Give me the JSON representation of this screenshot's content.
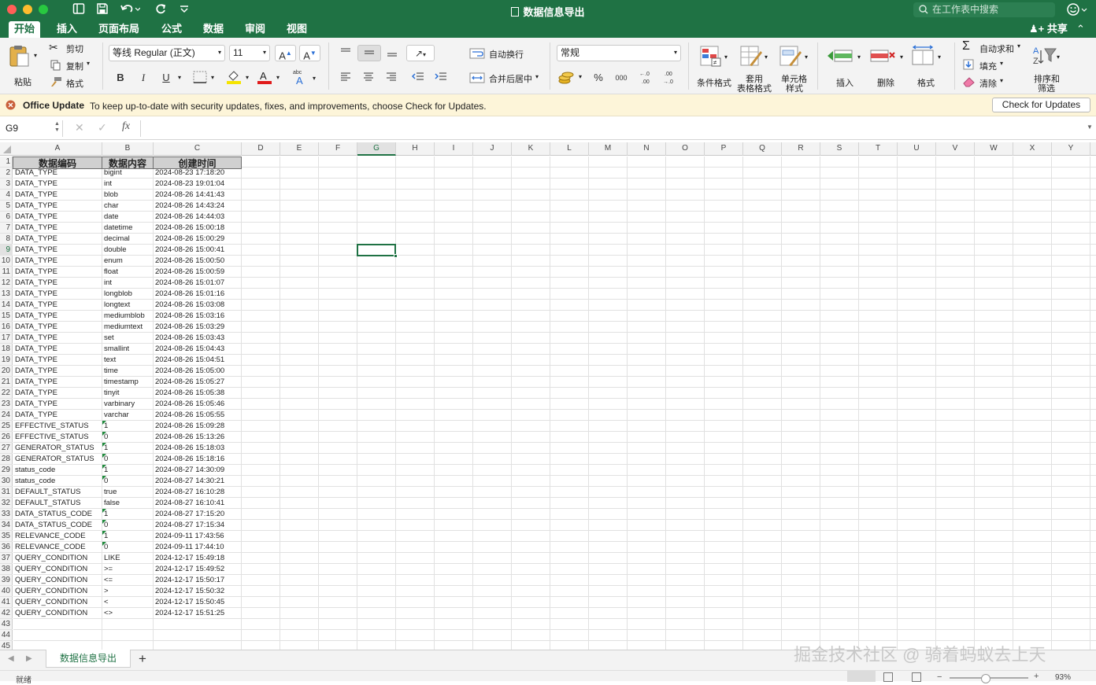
{
  "window": {
    "title": "数据信息导出",
    "search_placeholder": "在工作表中搜索"
  },
  "ribbon_tabs": [
    "开始",
    "插入",
    "页面布局",
    "公式",
    "数据",
    "审阅",
    "视图"
  ],
  "share_label": "共享",
  "clipboard": {
    "paste": "粘贴",
    "cut": "剪切",
    "copy": "复制",
    "format": "格式"
  },
  "font": {
    "name": "等线 Regular (正文)",
    "size": "11",
    "bold": "B",
    "italic": "I",
    "underline": "U",
    "grow": "A",
    "shrink": "A"
  },
  "alignment": {
    "wrap": "自动换行",
    "merge": "合并后居中"
  },
  "number": {
    "format": "常规",
    "percent": "%",
    "thousands": "000"
  },
  "styles": {
    "conditional": "条件格式",
    "table_fmt_1": "套用",
    "table_fmt_2": "表格格式",
    "cell_style_1": "单元格",
    "cell_style_2": "样式"
  },
  "cells_group": {
    "insert": "插入",
    "delete": "删除",
    "format": "格式"
  },
  "editing": {
    "autosum": "自动求和",
    "fill": "填充",
    "clear": "清除",
    "sort_1": "排序和",
    "sort_2": "筛选"
  },
  "update_notice": {
    "title": "Office Update",
    "message": "To keep up-to-date with security updates, fixes, and improvements, choose Check for Updates.",
    "button": "Check for Updates"
  },
  "formula_bar": {
    "name_box": "G9",
    "fx": "fx",
    "formula": ""
  },
  "columns": [
    "A",
    "B",
    "C",
    "D",
    "E",
    "F",
    "G",
    "H",
    "I",
    "J",
    "K",
    "L",
    "M",
    "N",
    "O",
    "P",
    "Q",
    "R",
    "S",
    "T",
    "U",
    "V",
    "W",
    "X",
    "Y"
  ],
  "selected_cell": "G9",
  "header_row": [
    "数据编码",
    "数据内容",
    "创建时间"
  ],
  "rows": [
    [
      "DATA_TYPE",
      "bigint",
      "2024-08-23 17:18:20"
    ],
    [
      "DATA_TYPE",
      "int",
      "2024-08-23 19:01:04"
    ],
    [
      "DATA_TYPE",
      "blob",
      "2024-08-26 14:41:43"
    ],
    [
      "DATA_TYPE",
      "char",
      "2024-08-26 14:43:24"
    ],
    [
      "DATA_TYPE",
      "date",
      "2024-08-26 14:44:03"
    ],
    [
      "DATA_TYPE",
      "datetime",
      "2024-08-26 15:00:18"
    ],
    [
      "DATA_TYPE",
      "decimal",
      "2024-08-26 15:00:29"
    ],
    [
      "DATA_TYPE",
      "double",
      "2024-08-26 15:00:41"
    ],
    [
      "DATA_TYPE",
      "enum",
      "2024-08-26 15:00:50"
    ],
    [
      "DATA_TYPE",
      "float",
      "2024-08-26 15:00:59"
    ],
    [
      "DATA_TYPE",
      "int",
      "2024-08-26 15:01:07"
    ],
    [
      "DATA_TYPE",
      "longblob",
      "2024-08-26 15:01:16"
    ],
    [
      "DATA_TYPE",
      "longtext",
      "2024-08-26 15:03:08"
    ],
    [
      "DATA_TYPE",
      "mediumblob",
      "2024-08-26 15:03:16"
    ],
    [
      "DATA_TYPE",
      "mediumtext",
      "2024-08-26 15:03:29"
    ],
    [
      "DATA_TYPE",
      "set",
      "2024-08-26 15:03:43"
    ],
    [
      "DATA_TYPE",
      "smallint",
      "2024-08-26 15:04:43"
    ],
    [
      "DATA_TYPE",
      "text",
      "2024-08-26 15:04:51"
    ],
    [
      "DATA_TYPE",
      "time",
      "2024-08-26 15:05:00"
    ],
    [
      "DATA_TYPE",
      "timestamp",
      "2024-08-26 15:05:27"
    ],
    [
      "DATA_TYPE",
      "tinyit",
      "2024-08-26 15:05:38"
    ],
    [
      "DATA_TYPE",
      "varbinary",
      "2024-08-26 15:05:46"
    ],
    [
      "DATA_TYPE",
      "varchar",
      "2024-08-26 15:05:55"
    ],
    [
      "EFFECTIVE_STATUS",
      "1",
      "2024-08-26 15:09:28"
    ],
    [
      "EFFECTIVE_STATUS",
      "0",
      "2024-08-26 15:13:26"
    ],
    [
      "GENERATOR_STATUS",
      "1",
      "2024-08-26 15:18:03"
    ],
    [
      "GENERATOR_STATUS",
      "0",
      "2024-08-26 15:18:16"
    ],
    [
      "status_code",
      "1",
      "2024-08-27 14:30:09"
    ],
    [
      "status_code",
      "0",
      "2024-08-27 14:30:21"
    ],
    [
      "DEFAULT_STATUS",
      "true",
      "2024-08-27 16:10:28"
    ],
    [
      "DEFAULT_STATUS",
      "false",
      "2024-08-27 16:10:41"
    ],
    [
      "DATA_STATUS_CODE",
      "1",
      "2024-08-27 17:15:20"
    ],
    [
      "DATA_STATUS_CODE",
      "0",
      "2024-08-27 17:15:34"
    ],
    [
      "RELEVANCE_CODE",
      "1",
      "2024-09-11 17:43:56"
    ],
    [
      "RELEVANCE_CODE",
      "0",
      "2024-09-11 17:44:10"
    ],
    [
      "QUERY_CONDITION",
      "LIKE",
      "2024-12-17 15:49:18"
    ],
    [
      "QUERY_CONDITION",
      ">=",
      "2024-12-17 15:49:52"
    ],
    [
      "QUERY_CONDITION",
      "<=",
      "2024-12-17 15:50:17"
    ],
    [
      "QUERY_CONDITION",
      ">",
      "2024-12-17 15:50:32"
    ],
    [
      "QUERY_CONDITION",
      "<",
      "2024-12-17 15:50:45"
    ],
    [
      "QUERY_CONDITION",
      "<>",
      "2024-12-17 15:51:25"
    ]
  ],
  "extra_row_numbers": [
    "43",
    "44",
    "45"
  ],
  "sheet_tab": "数据信息导出",
  "add_sheet": "+",
  "watermark": "掘金技术社区 @ 骑着蚂蚁去上天",
  "status": {
    "ready": "就绪",
    "zoom": "93%"
  },
  "colors": {
    "excel_green": "#1f7244",
    "notice_bg": "#fdf5d9",
    "error_triangle": "#1f8a3c"
  }
}
